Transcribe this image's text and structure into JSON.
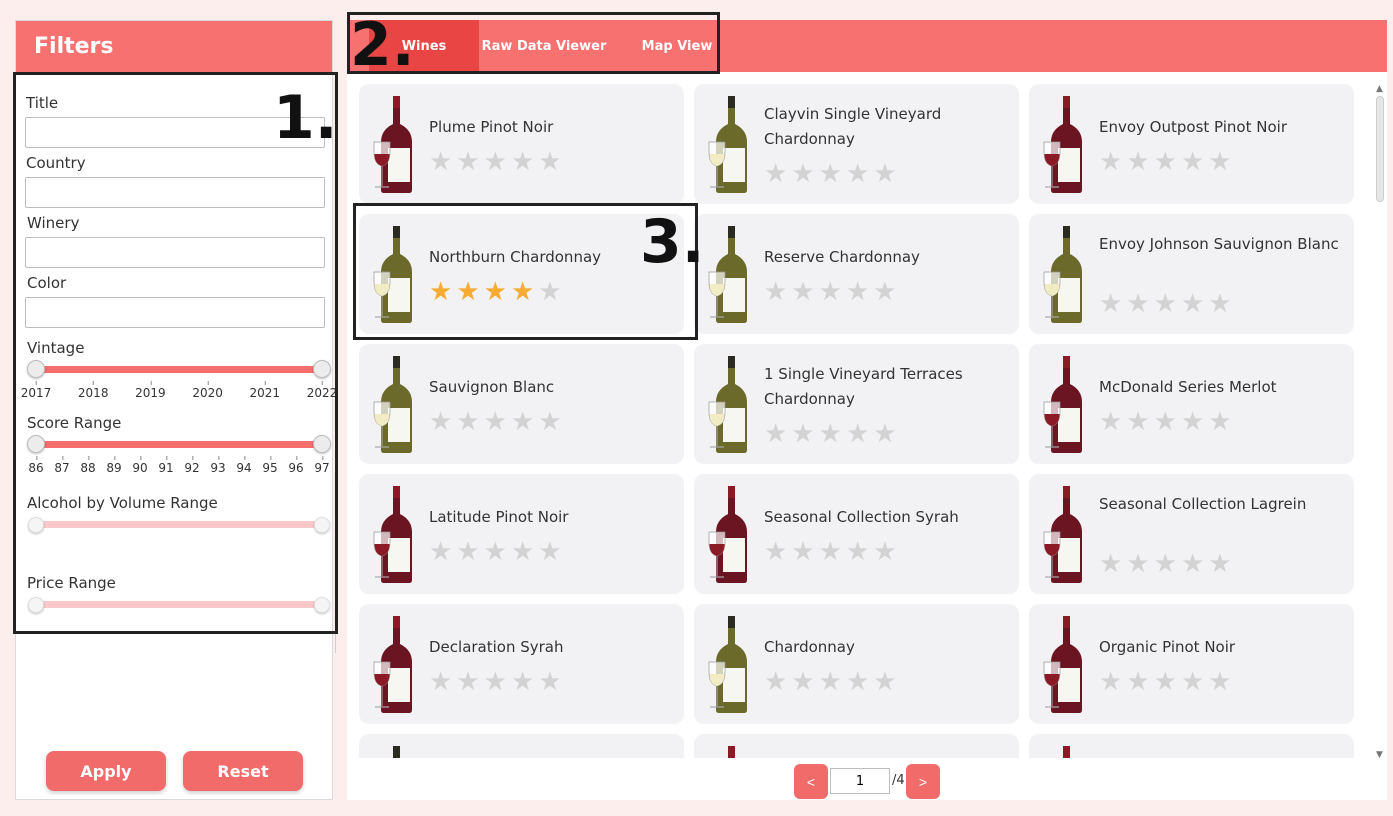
{
  "sidebar": {
    "title": "Filters",
    "fields": {
      "title_label": "Title",
      "country_label": "Country",
      "winery_label": "Winery",
      "color_label": "Color",
      "title_value": "",
      "country_value": "",
      "winery_value": "",
      "color_value": ""
    },
    "vintage": {
      "label": "Vintage",
      "ticks": [
        "2017",
        "2018",
        "2019",
        "2020",
        "2021",
        "2022"
      ],
      "range": [
        2017,
        2022
      ]
    },
    "score": {
      "label": "Score Range",
      "ticks": [
        "86",
        "87",
        "88",
        "89",
        "90",
        "91",
        "92",
        "93",
        "94",
        "95",
        "96",
        "97"
      ],
      "range": [
        86,
        97
      ]
    },
    "abv": {
      "label": "Alcohol by Volume Range"
    },
    "price": {
      "label": "Price Range"
    },
    "apply_label": "Apply",
    "reset_label": "Reset"
  },
  "tabs": {
    "wines": "Wines",
    "raw": "Raw Data Viewer",
    "map": "Map View",
    "active": "Wines"
  },
  "wines": [
    {
      "name": "Plume Pinot Noir",
      "color": "red",
      "rating": 0
    },
    {
      "name": "Clayvin Single Vineyard Chardonnay",
      "color": "white",
      "rating": 0
    },
    {
      "name": "Envoy Outpost Pinot Noir",
      "color": "red",
      "rating": 0
    },
    {
      "name": "Northburn Chardonnay",
      "color": "white",
      "rating": 4
    },
    {
      "name": "Reserve Chardonnay",
      "color": "white",
      "rating": 0
    },
    {
      "name": "Envoy Johnson Sauvignon Blanc",
      "color": "white",
      "rating": 0
    },
    {
      "name": "Sauvignon Blanc",
      "color": "white",
      "rating": 0
    },
    {
      "name": "1 Single Vineyard Terraces Chardonnay",
      "color": "white",
      "rating": 0
    },
    {
      "name": "McDonald Series Merlot",
      "color": "red",
      "rating": 0
    },
    {
      "name": "Latitude Pinot Noir",
      "color": "red",
      "rating": 0
    },
    {
      "name": "Seasonal Collection Syrah",
      "color": "red",
      "rating": 0
    },
    {
      "name": "Seasonal Collection Lagrein",
      "color": "red",
      "rating": 0
    },
    {
      "name": "Declaration Syrah",
      "color": "red",
      "rating": 0
    },
    {
      "name": "Chardonnay",
      "color": "white",
      "rating": 0
    },
    {
      "name": "Organic Pinot Noir",
      "color": "red",
      "rating": 0
    },
    {
      "name": "",
      "color": "white",
      "rating": 0
    },
    {
      "name": "",
      "color": "red",
      "rating": 0
    },
    {
      "name": "",
      "color": "red",
      "rating": 0
    }
  ],
  "pagination": {
    "prev_label": "<",
    "next_label": ">",
    "current_page": "1",
    "total_label": "/4"
  },
  "annotations": {
    "one": "1.",
    "two": "2.",
    "three": "3."
  },
  "colors": {
    "accent": "#f87171",
    "active_tab": "#ea4545",
    "button": "#f26b6b",
    "star_on": "#f6ac32",
    "star_off": "#d3d3d3",
    "red_wine": "#6b1422",
    "white_wine": "#6b6a2a"
  }
}
